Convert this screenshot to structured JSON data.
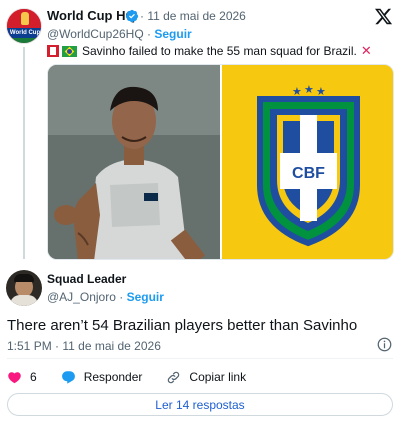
{
  "quoted_tweet": {
    "author_name": "World Cup HQ",
    "avatar_text": "World Cup",
    "date": "· 11 de mai de 2026",
    "handle": "@WorldCup26HQ",
    "separator": "·",
    "follow_label": "Seguir",
    "text": "Savinho failed to make the 55 man squad for Brazil.",
    "media_badge_text": "CBF"
  },
  "main_tweet": {
    "author_name": "Squad Leader",
    "handle": "@AJ_Onjoro",
    "separator": "·",
    "follow_label": "Seguir",
    "text": "There aren’t 54 Brazilian players better than Savinho",
    "timestamp": "1:51 PM · 11 de mai de 2026"
  },
  "actions": {
    "likes_count": "6",
    "reply_label": "Responder",
    "copy_label": "Copiar link"
  },
  "replies_button_label": "Ler 14 respostas",
  "colors": {
    "accent": "#1d9bf0",
    "like": "#f91880",
    "text_secondary": "#536471",
    "cbf_yellow": "#f6c80f",
    "cbf_blue": "#1f4ea1",
    "cbf_green": "#00923f"
  },
  "icons": [
    "verified-badge-icon",
    "x-logo-icon",
    "canada-flag-icon",
    "brazil-flag-icon",
    "cross-mark-icon",
    "info-icon",
    "heart-icon",
    "reply-bubble-icon",
    "link-icon"
  ]
}
